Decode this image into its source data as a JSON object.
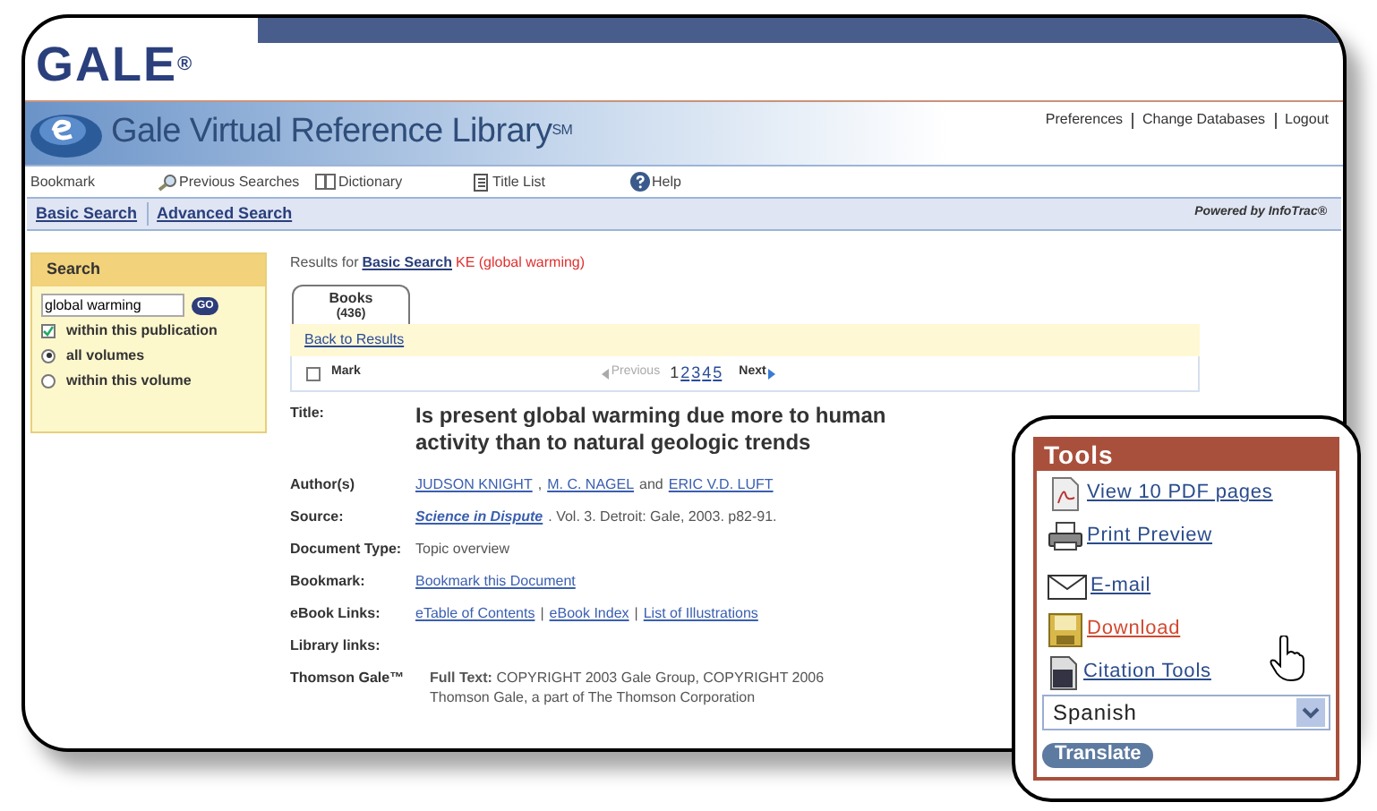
{
  "header": {
    "logo": "GALE",
    "logo_mark": "®",
    "title": "Gale Virtual Reference Library",
    "title_mark": "SM",
    "links": [
      "Preferences",
      "Change Databases",
      "Logout"
    ]
  },
  "nav": [
    {
      "label": "Bookmark",
      "kind": "plain"
    },
    {
      "label": "Previous Searches",
      "kind": "search"
    },
    {
      "label": "Dictionary",
      "kind": "book"
    },
    {
      "label": "Title List",
      "kind": "list"
    },
    {
      "label": "Help",
      "kind": "help"
    }
  ],
  "tabs": [
    "Basic Search",
    "Advanced Search"
  ],
  "powered_by": "Powered by InfoTrac®",
  "search": {
    "title": "Search",
    "value": "global warming",
    "button": "GO",
    "options": [
      {
        "kind": "checkbox",
        "label": "within this publication",
        "checked": true
      },
      {
        "kind": "radio",
        "label": "all volumes",
        "selected": true
      },
      {
        "kind": "radio",
        "label": "within this volume",
        "selected": false
      }
    ]
  },
  "results": {
    "prefix": "Results for",
    "link": "Basic Search",
    "query": "KE (global warming)",
    "tab": {
      "label": "Books",
      "count": "(436)"
    },
    "back": "Back to Results",
    "mark": {
      "label": "Mark",
      "checked": false
    },
    "previous": "Previous",
    "pages": [
      {
        "label": "1",
        "selected": true
      },
      {
        "label": "2",
        "selected": false
      },
      {
        "label": "3",
        "selected": false
      },
      {
        "label": "4",
        "selected": false
      },
      {
        "label": "5",
        "selected": false
      }
    ],
    "next": "Next"
  },
  "document": [
    {
      "label": "Title:",
      "kind": "title",
      "text": "Is present global warming due more to human activity than to natural geologic trends"
    },
    {
      "label": "Author(s)",
      "kind": "parts",
      "parts": [
        {
          "text": "JUDSON KNIGHT",
          "link": true
        },
        {
          "text": ",",
          "link": false
        },
        {
          "text": "M. C. NAGEL",
          "link": true
        },
        {
          "text": "and",
          "link": false
        },
        {
          "text": "ERIC V.D. LUFT",
          "link": true
        }
      ]
    },
    {
      "label": "Source:",
      "kind": "parts",
      "parts": [
        {
          "text": "Science in Dispute",
          "link": true,
          "emphasis": true
        },
        {
          "text": ". Vol. 3. Detroit: Gale, 2003. p82-91.",
          "link": false
        }
      ]
    },
    {
      "label": "Document Type:",
      "kind": "parts",
      "parts": [
        {
          "text": "Topic overview",
          "link": false
        }
      ]
    },
    {
      "label": "Bookmark:",
      "kind": "parts",
      "parts": [
        {
          "text": "Bookmark this Document",
          "link": true
        }
      ]
    },
    {
      "label": "eBook Links:",
      "kind": "parts",
      "parts": [
        {
          "text": "eTable of Contents",
          "link": true
        },
        {
          "text": "|",
          "link": false
        },
        {
          "text": "eBook Index",
          "link": true
        },
        {
          "text": "|",
          "link": false
        },
        {
          "text": "List of Illustrations",
          "link": true
        }
      ]
    },
    {
      "label": "Library links:",
      "kind": "parts"
    },
    {
      "label": "Thomson Gale™",
      "kind": "fulltext",
      "text": "**Full Text:** COPYRIGHT 2003 Gale Group, COPYRIGHT 2006 Thomson Gale, a part of The Thomson Corporation"
    }
  ],
  "tools": {
    "title": "Tools",
    "items": [
      {
        "label": "View 10 PDF pages",
        "kind": "pdf",
        "hovered": false
      },
      {
        "label": "Print Preview",
        "kind": "print",
        "hovered": false
      },
      {
        "label": "E-mail",
        "kind": "email",
        "hovered": false
      },
      {
        "label": "Download",
        "kind": "download",
        "hovered": true
      },
      {
        "label": "Citation Tools",
        "kind": "citation",
        "hovered": false
      }
    ],
    "language": "Spanish",
    "button": "Translate"
  }
}
